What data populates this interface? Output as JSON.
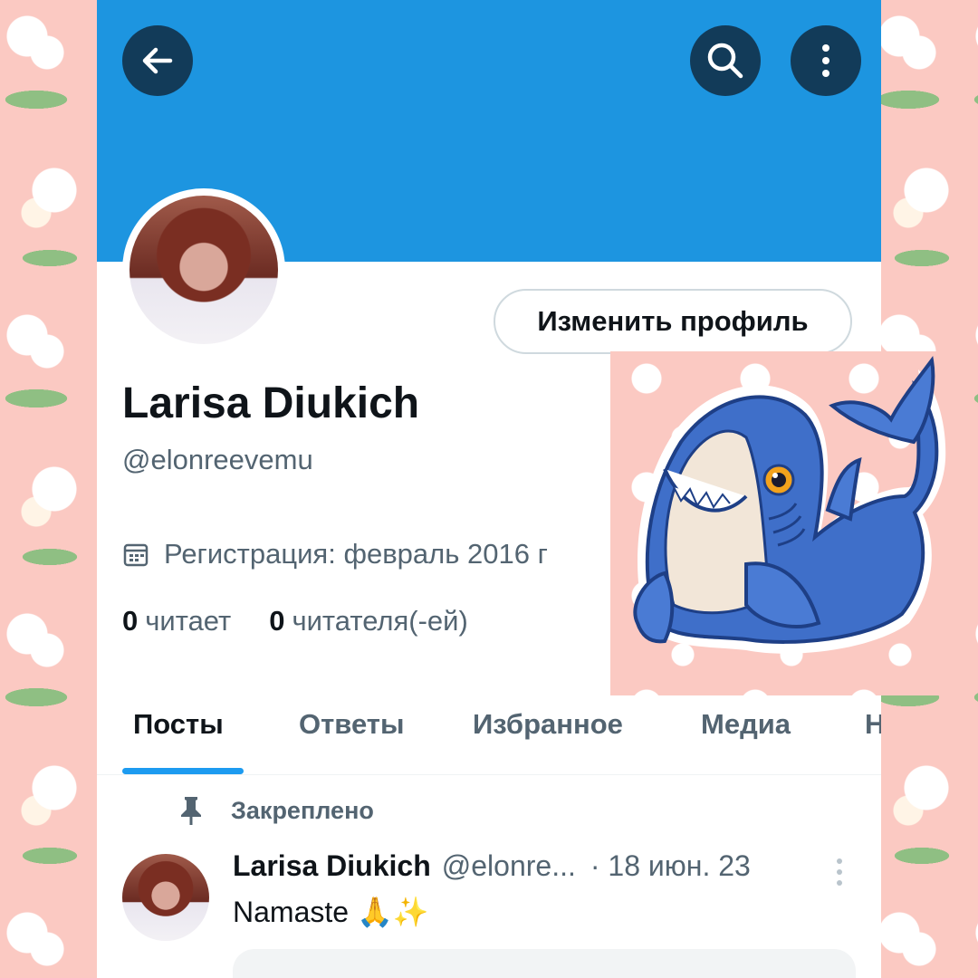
{
  "nav": {
    "back_icon": "arrow-left-icon",
    "search_icon": "search-icon",
    "more_icon": "more-vertical-icon"
  },
  "profile": {
    "name": "Larisa Diukich",
    "handle": "@elonreevemu",
    "edit_button": "Изменить профиль",
    "joined": "Регистрация: февраль 2016 г",
    "following_count": "0",
    "following_label": "читает",
    "followers_count": "0",
    "followers_label": "читателя(-ей)"
  },
  "tabs": [
    {
      "label": "Посты",
      "active": true
    },
    {
      "label": "Ответы",
      "active": false
    },
    {
      "label": "Избранное",
      "active": false
    },
    {
      "label": "Медиа",
      "active": false
    },
    {
      "label": "Н",
      "active": false
    }
  ],
  "post": {
    "pinned_label": "Закреплено",
    "author": "Larisa Diukich",
    "handle": "@elonre...",
    "date": "· 18 июн. 23",
    "text": "Namaste 🙏✨"
  },
  "colors": {
    "banner": "#1d95e0",
    "accent": "#1d9bf0",
    "nav_button": "#123b59",
    "background": "#fbc9c2"
  }
}
